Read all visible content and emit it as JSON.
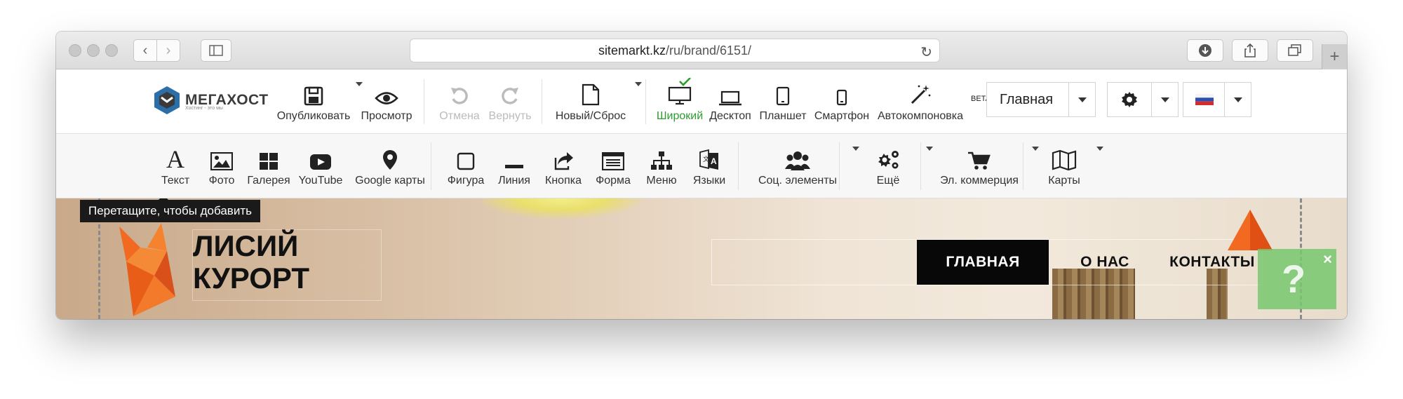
{
  "browser": {
    "url_host": "sitemarkt.kz",
    "url_path": "/ru/brand/6151/"
  },
  "logo": {
    "name": "МЕГАХОСТ",
    "tagline": "Хостинг - это мы"
  },
  "top_tools": [
    {
      "id": "publish",
      "label": "Опубликовать",
      "icon": "save-icon",
      "state": "normal"
    },
    {
      "id": "preview",
      "label": "Просмотр",
      "icon": "eye-icon",
      "state": "normal"
    },
    {
      "id": "undo",
      "label": "Отмена",
      "icon": "undo-icon",
      "state": "disabled"
    },
    {
      "id": "redo",
      "label": "Вернуть",
      "icon": "redo-icon",
      "state": "disabled"
    },
    {
      "id": "new",
      "label": "Новый/Сброс",
      "icon": "document-icon",
      "state": "normal"
    },
    {
      "id": "wide",
      "label": "Широкий",
      "icon": "monitor-icon",
      "state": "active"
    },
    {
      "id": "desktop",
      "label": "Десктоп",
      "icon": "laptop-icon",
      "state": "normal"
    },
    {
      "id": "tablet",
      "label": "Планшет",
      "icon": "tablet-icon",
      "state": "normal"
    },
    {
      "id": "phone",
      "label": "Смартфон",
      "icon": "phone-icon",
      "state": "normal"
    },
    {
      "id": "autolayout",
      "label": "Автокомпоновка",
      "icon": "magic-wand-icon",
      "state": "normal",
      "badge": "BETA"
    }
  ],
  "page_select": {
    "value": "Главная"
  },
  "bottom_tools": [
    {
      "id": "text",
      "label": "Текст",
      "icon": "text-icon"
    },
    {
      "id": "photo",
      "label": "Фото",
      "icon": "image-icon"
    },
    {
      "id": "gallery",
      "label": "Галерея",
      "icon": "gallery-icon"
    },
    {
      "id": "youtube",
      "label": "YouTube",
      "icon": "youtube-icon"
    },
    {
      "id": "gmaps",
      "label": "Google карты",
      "icon": "map-pin-icon"
    },
    {
      "id": "shape",
      "label": "Фигура",
      "icon": "square-icon"
    },
    {
      "id": "line",
      "label": "Линия",
      "icon": "line-icon"
    },
    {
      "id": "button",
      "label": "Кнопка",
      "icon": "share-icon"
    },
    {
      "id": "form",
      "label": "Форма",
      "icon": "form-icon"
    },
    {
      "id": "menu",
      "label": "Меню",
      "icon": "sitemap-icon"
    },
    {
      "id": "langs",
      "label": "Языки",
      "icon": "translate-icon"
    },
    {
      "id": "social",
      "label": "Соц. элементы",
      "icon": "users-icon"
    },
    {
      "id": "more",
      "label": "Ещё",
      "icon": "gears-icon"
    },
    {
      "id": "ecom",
      "label": "Эл. коммерция",
      "icon": "cart-icon"
    },
    {
      "id": "maps",
      "label": "Карты",
      "icon": "map-icon"
    }
  ],
  "tooltip": "Перетащите, чтобы добавить",
  "site": {
    "title_line1": "ЛИСИЙ",
    "title_line2": "КУРОРТ",
    "menu": [
      "ГЛАВНАЯ",
      "О НАС",
      "КОНТАКТЫ"
    ],
    "help": "?",
    "close": "×"
  },
  "colors": {
    "active_green": "#2e9c2e",
    "menu_active_bg": "#080808",
    "help_green": "#78c86e"
  }
}
